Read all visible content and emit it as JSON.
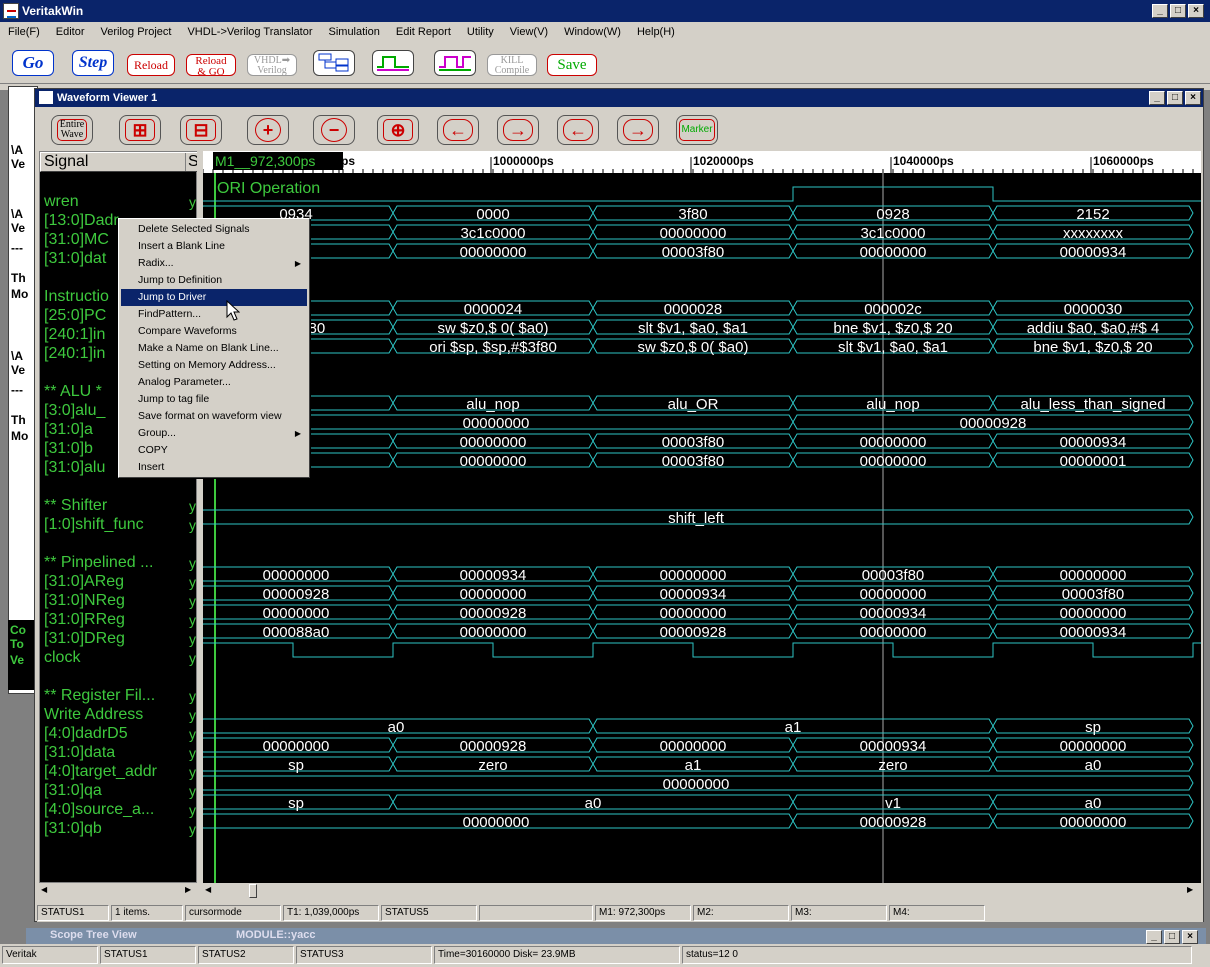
{
  "app": {
    "title": "VeritakWin",
    "window_controls": [
      "_",
      "□",
      "×"
    ]
  },
  "menu": [
    "File(F)",
    "Editor",
    "Verilog Project",
    "VHDL->Verilog Translator",
    "Simulation",
    "Edit Report",
    "Utility",
    "View(V)",
    "Window(W)",
    "Help(H)"
  ],
  "toolbar": {
    "go": "Go",
    "step": "Step",
    "reload": "Reload",
    "reload_go_1": "Reload",
    "reload_go_2": "& GO",
    "vhdl_1": "VHDL➡",
    "vhdl_2": "Verilog",
    "kill_1": "KILL",
    "kill_2": "Compile",
    "save": "Save"
  },
  "bg_text": [
    "\\A",
    "Ve",
    "\\A",
    "Ve",
    "---",
    "Th",
    "Mo",
    "\\A",
    "Ve",
    "---",
    "Th",
    "Mo",
    "Co",
    "To",
    "Ve"
  ],
  "viewer": {
    "title": "Waveform Viewer 1",
    "entire_wave_1": "Entire",
    "entire_wave_2": "Wave",
    "marker": "Marker"
  },
  "signal_header": "Signal",
  "signal_header_s": "S",
  "signals": [
    "",
    "wren",
    "[13:0]Dadr",
    "[31:0]MC",
    "[31:0]dat",
    "",
    "Instructio",
    "[25:0]PC",
    "[240:1]in",
    "[240:1]in",
    "",
    "** ALU *",
    "[3:0]alu_",
    "[31:0]a",
    "[31:0]b",
    "[31:0]alu",
    "",
    "** Shifter",
    "[1:0]shift_func",
    "",
    "** Pinpelined ...",
    "[31:0]AReg",
    "[31:0]NReg",
    "[31:0]RReg",
    "[31:0]DReg",
    "clock",
    "",
    "** Register Fil...",
    "  Write Address",
    "[4:0]dadrD5",
    "[31:0]data",
    "[4:0]target_addr",
    "[31:0]qa",
    "[4:0]source_a...",
    "[31:0]qb"
  ],
  "signal_values": [
    "y",
    "y",
    "y",
    "y",
    "y",
    "y",
    "y",
    "y",
    "y",
    "y",
    "y",
    "y",
    "y",
    "y",
    "y",
    "y",
    "y",
    "y",
    "y",
    "y",
    "y",
    "y",
    "y",
    "y",
    "y",
    "y"
  ],
  "ruler": {
    "marker_label": "M1__972,300ps",
    "ticks": [
      "ps",
      "1000000ps",
      "1020000ps",
      "1040000ps",
      "1060000ps"
    ]
  },
  "wave_label": "ORI Operation",
  "buses": [
    {
      "row": 2,
      "segs": [
        "0934",
        "0000",
        "3f80",
        "0928",
        "2152"
      ]
    },
    {
      "row": 3,
      "segs": [
        "000",
        "3c1c0000",
        "00000000",
        "3c1c0000",
        "xxxxxxxx"
      ]
    },
    {
      "row": 4,
      "segs": [
        "934",
        "00000000",
        "00003f80",
        "00000000",
        "00000934"
      ]
    },
    {
      "row": 7,
      "segs": [
        "20",
        "0000024",
        "0000028",
        "000002c",
        "0000030"
      ]
    },
    {
      "row": 8,
      "segs": [
        "p,#$3f80",
        "sw  $z0,$    0( $a0)",
        "slt  $v1, $a0, $a1",
        "bne  $v1, $z0,$      20",
        "addiu  $a0, $a0,#$    4"
      ]
    },
    {
      "row": 9,
      "segs": [
        "#$    0",
        "ori  $sp, $sp,#$3f80",
        "sw  $z0,$    0( $a0)",
        "slt  $v1, $a0, $a1",
        "bne  $v1, $z0,$      20"
      ]
    },
    {
      "row": 12,
      "segs": [
        "OR",
        "alu_nop",
        "alu_OR",
        "alu_nop",
        "alu_less_than_signed"
      ]
    },
    {
      "row": 13,
      "segs": [
        "",
        "00000000",
        "",
        "00000928",
        ""
      ],
      "merge": [
        [
          0,
          3
        ],
        [
          3,
          5
        ]
      ]
    },
    {
      "row": 14,
      "segs": [
        "934",
        "00000000",
        "00003f80",
        "00000000",
        "00000934"
      ]
    },
    {
      "row": 15,
      "segs": [
        "934",
        "00000000",
        "00003f80",
        "00000000",
        "00000001"
      ]
    },
    {
      "row": 18,
      "segs": [
        "shift_left"
      ],
      "full": true
    },
    {
      "row": 21,
      "segs": [
        "00000000",
        "00000934",
        "00000000",
        "00003f80",
        "00000000"
      ]
    },
    {
      "row": 22,
      "segs": [
        "00000928",
        "00000000",
        "00000934",
        "00000000",
        "00003f80"
      ]
    },
    {
      "row": 23,
      "segs": [
        "00000000",
        "00000928",
        "00000000",
        "00000934",
        "00000000"
      ]
    },
    {
      "row": 24,
      "segs": [
        "000088a0",
        "00000000",
        "00000928",
        "00000000",
        "00000934"
      ]
    },
    {
      "row": 29,
      "segs": [
        "a0",
        "a1",
        "sp"
      ],
      "wide": true
    },
    {
      "row": 30,
      "segs": [
        "00000000",
        "00000928",
        "00000000",
        "00000934",
        "00000000"
      ]
    },
    {
      "row": 31,
      "segs": [
        "sp",
        "zero",
        "a1",
        "zero",
        "a0"
      ]
    },
    {
      "row": 32,
      "segs": [
        "00000000"
      ],
      "full": true
    },
    {
      "row": 33,
      "segs": [
        "sp",
        "a0",
        "v1",
        "a0"
      ],
      "src": true
    },
    {
      "row": 34,
      "segs": [
        "00000000",
        "00000928",
        "00000000"
      ],
      "qb": true
    }
  ],
  "context_menu": [
    {
      "label": "Delete Selected Signals"
    },
    {
      "label": "Insert a Blank Line"
    },
    {
      "label": "Radix...",
      "sub": true
    },
    {
      "label": "Jump to Definition"
    },
    {
      "label": "Jump to Driver",
      "selected": true
    },
    {
      "label": "FindPattern..."
    },
    {
      "label": "Compare Waveforms"
    },
    {
      "label": "Make a Name on Blank Line..."
    },
    {
      "label": "Setting on Memory Address..."
    },
    {
      "label": "Analog Parameter..."
    },
    {
      "label": "Jump to tag file"
    },
    {
      "label": "Save format on waveform view"
    },
    {
      "label": "Group...",
      "sub": true
    },
    {
      "label": "COPY"
    },
    {
      "label": "Insert"
    }
  ],
  "status": {
    "s1": "STATUS1",
    "items": "1 items.",
    "mode": "cursormode",
    "t1": "T1: 1,039,000ps",
    "s5": "STATUS5",
    "m1": "M1: 972,300ps",
    "m2": "M2:",
    "m3": "M3:",
    "m4": "M4:"
  },
  "bottom_window": {
    "title": "Scope Tree View",
    "module": "MODULE::yacc"
  },
  "app_status": {
    "a": "Veritak",
    "b": "STATUS1",
    "c": "STATUS2",
    "d": "STATUS3",
    "e": "Time=30160000 Disk= 23.9MB",
    "f": "status=12 0"
  }
}
